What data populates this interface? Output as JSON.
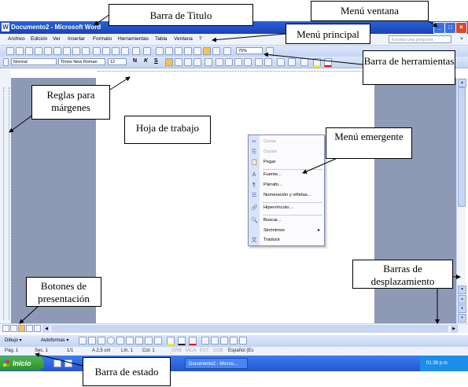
{
  "window": {
    "title": "Documento2 - Microsoft Word",
    "app_icon": "W",
    "minimize_glyph": "_",
    "maximize_glyph": "□",
    "close_glyph": "×"
  },
  "menu": {
    "items": [
      "Archivo",
      "Edición",
      "Ver",
      "Insertar",
      "Formato",
      "Herramientas",
      "Tabla",
      "Ventana",
      "?"
    ],
    "help_placeholder": "Escriba una pregunta",
    "help_close": "×"
  },
  "standard_toolbar": {
    "zoom": "75%"
  },
  "format_toolbar": {
    "style": "Normal",
    "font": "Times New Roman",
    "size": "12",
    "bold": "N",
    "italic": "K",
    "underline": "S"
  },
  "context_menu": {
    "items": [
      {
        "icon": "✂",
        "label": "Cortar",
        "disabled": true
      },
      {
        "icon": "⎘",
        "label": "Copiar",
        "disabled": true
      },
      {
        "icon": "📋",
        "label": "Pegar",
        "disabled": false
      },
      {
        "icon": "A",
        "label": "Fuente...",
        "disabled": false
      },
      {
        "icon": "¶",
        "label": "Párrafo...",
        "disabled": false
      },
      {
        "icon": "☰",
        "label": "Numeración y viñetas...",
        "disabled": false
      },
      {
        "icon": "🔗",
        "label": "Hipervínculo...",
        "disabled": false
      },
      {
        "icon": "🔍",
        "label": "Buscar...",
        "disabled": false
      },
      {
        "icon": "",
        "label": "Sinónimos",
        "disabled": false,
        "submenu": "▸"
      },
      {
        "icon": "文",
        "label": "Traducir",
        "disabled": false
      }
    ]
  },
  "draw_toolbar": {
    "draw_label": "Dibujo ▾",
    "autoshapes_label": "Autoformas ▾"
  },
  "status_bar": {
    "page": "Pág. 1",
    "section": "Sec. 1",
    "position": "1/1",
    "at": "A 2,5 cm",
    "line": "Lín. 1",
    "col": "Col. 1",
    "modes": [
      "GRB",
      "MCA",
      "EXT",
      "SOB"
    ],
    "language": "Español (Es"
  },
  "taskbar": {
    "start_label": "Inicio",
    "task_label": "Documento2 - Micros...",
    "clock": "01:38 p.m."
  },
  "callouts": {
    "title_bar": "Barra de Titulo",
    "window_menu": "Menú ventana",
    "main_menu": "Menú principal",
    "toolbars": "Barra de herramientas",
    "rulers": "Reglas para márgenes",
    "worksheet": "Hoja de trabajo",
    "context_menu": "Menú emergente",
    "scrollbars": "Barras de desplazamiento",
    "view_buttons": "Botones de presentación",
    "status_bar": "Barra de estado"
  }
}
